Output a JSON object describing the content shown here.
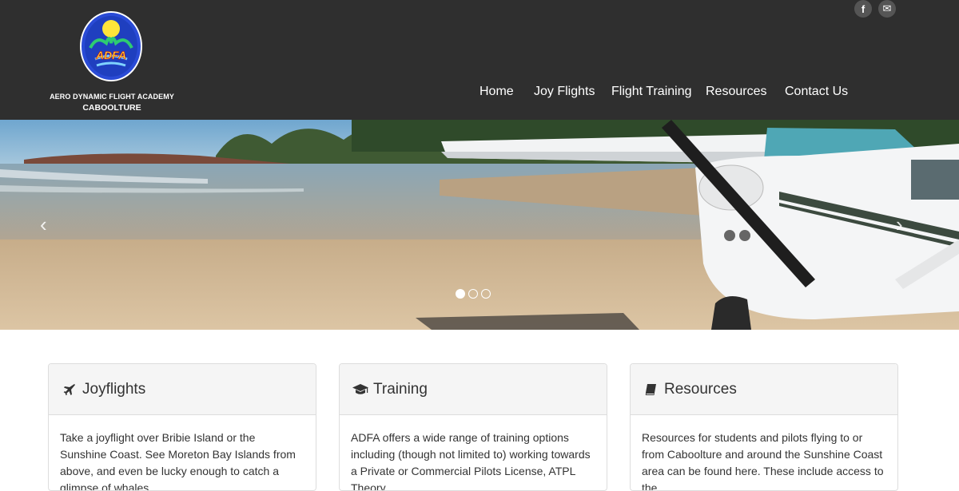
{
  "brand": {
    "badge_text": "ADFA",
    "name_line1": "AERO DYNAMIC FLIGHT ACADEMY",
    "name_line2": "CABOOLTURE"
  },
  "social": [
    {
      "label": "f",
      "icon": "facebook-icon"
    },
    {
      "label": "✉",
      "icon": "envelope-icon"
    }
  ],
  "nav": {
    "items": [
      "Home",
      "Joy Flights",
      "Flight Training",
      "Resources",
      "Contact Us"
    ]
  },
  "carousel": {
    "prev_glyph": "‹",
    "next_glyph": "›",
    "slide_count": 3,
    "active_slide": 1
  },
  "panels": [
    {
      "title": "Joyflights",
      "icon": "plane-icon",
      "body": "Take a joyflight over Bribie Island or the Sunshine Coast. See Moreton Bay Islands from above, and even be lucky enough to catch a glimpse of whales"
    },
    {
      "title": "Training",
      "icon": "graduation-cap-icon",
      "body": "ADFA offers a wide range of training options including (though not limited to) working towards a Private or Commercial Pilots License, ATPL Theory"
    },
    {
      "title": "Resources",
      "icon": "book-icon",
      "body": "Resources for students and pilots flying to or from Caboolture and around the Sunshine Coast area can be found here. These include access to the"
    }
  ]
}
